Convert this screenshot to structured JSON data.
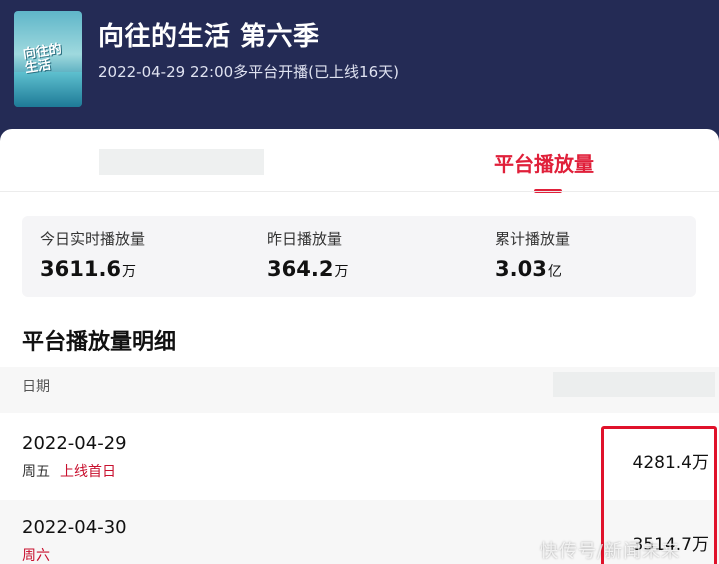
{
  "show": {
    "poster_logo": "向往的生活",
    "title": "向往的生活 第六季",
    "subtitle": "2022-04-29 22:00多平台开播(已上线16天)"
  },
  "tabs": {
    "active_label": "平台播放量"
  },
  "stats": [
    {
      "label": "今日实时播放量",
      "value": "3611.6",
      "unit": "万"
    },
    {
      "label": "昨日播放量",
      "value": "364.2",
      "unit": "万"
    },
    {
      "label": "累计播放量",
      "value": "3.03",
      "unit": "亿"
    }
  ],
  "detail": {
    "title": "平台播放量明细",
    "column_date": "日期",
    "rows": [
      {
        "date": "2022-04-29",
        "weekday": "周五",
        "flag": "上线首日",
        "value": "4281.4万"
      },
      {
        "date": "2022-04-30",
        "weekday": "周六",
        "flag": "",
        "value": "3514.7万"
      }
    ]
  },
  "colors": {
    "accent": "#e0203a",
    "header_bg": "#242b55"
  },
  "watermark": "快传号/新闻未来"
}
